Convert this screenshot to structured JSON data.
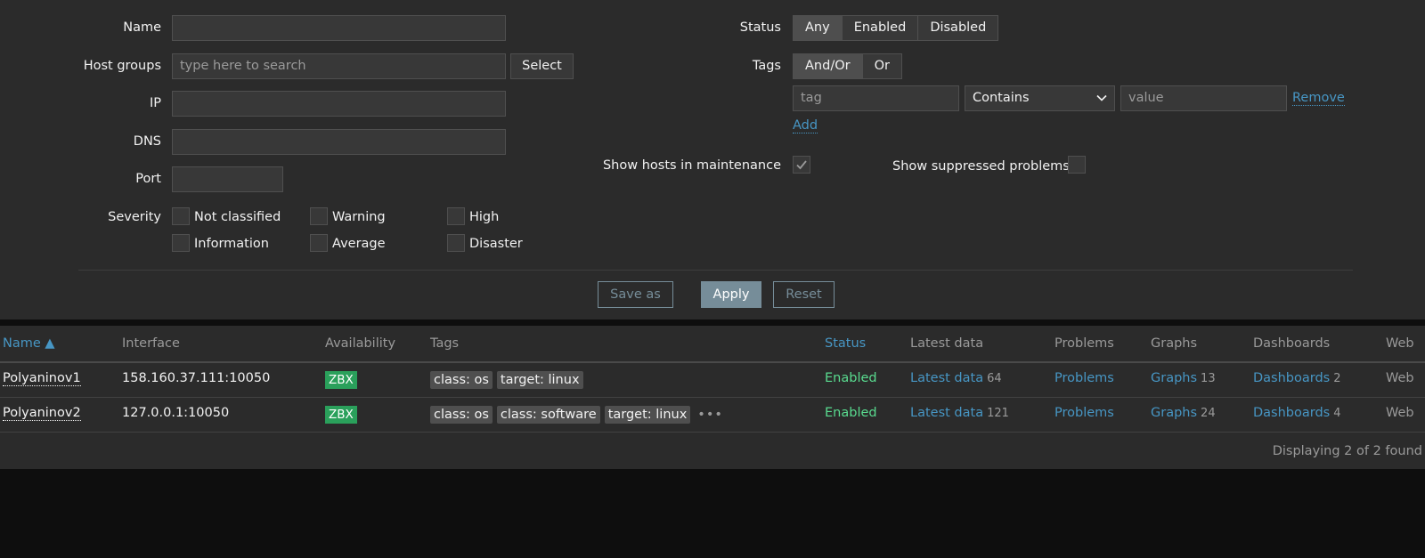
{
  "filter": {
    "name_label": "Name",
    "name_value": "",
    "hostgroups_label": "Host groups",
    "hostgroups_placeholder": "type here to search",
    "select_label": "Select",
    "ip_label": "IP",
    "ip_value": "",
    "dns_label": "DNS",
    "dns_value": "",
    "port_label": "Port",
    "port_value": "",
    "severity_label": "Severity",
    "severities": [
      "Not classified",
      "Warning",
      "High",
      "Information",
      "Average",
      "Disaster"
    ],
    "status_label": "Status",
    "status_options": [
      "Any",
      "Enabled",
      "Disabled"
    ],
    "status_selected": "Any",
    "tags_label": "Tags",
    "tags_options": [
      "And/Or",
      "Or"
    ],
    "tags_selected": "And/Or",
    "tag_placeholder": "tag",
    "tag_operator": "Contains",
    "value_placeholder": "value",
    "remove_label": "Remove",
    "add_label": "Add",
    "maintenance_label": "Show hosts in maintenance",
    "maintenance_checked": true,
    "suppressed_label": "Show suppressed problems",
    "suppressed_checked": false,
    "save_as_label": "Save as",
    "apply_label": "Apply",
    "reset_label": "Reset"
  },
  "table": {
    "columns": [
      "Name ▲",
      "Interface",
      "Availability",
      "Tags",
      "Status",
      "Latest data",
      "Problems",
      "Graphs",
      "Dashboards",
      "Web"
    ],
    "rows": [
      {
        "name": "Polyaninov1",
        "interface": "158.160.37.111:10050",
        "availability": "ZBX",
        "tags": [
          "class: os",
          "target: linux"
        ],
        "more_tags": "",
        "status": "Enabled",
        "latest_label": "Latest data",
        "latest_count": "64",
        "problems": "Problems",
        "graphs_label": "Graphs",
        "graphs_count": "13",
        "dashboards_label": "Dashboards",
        "dashboards_count": "2",
        "web": "Web"
      },
      {
        "name": "Polyaninov2",
        "interface": "127.0.0.1:10050",
        "availability": "ZBX",
        "tags": [
          "class: os",
          "class: software",
          "target: linux"
        ],
        "more_tags": "•••",
        "status": "Enabled",
        "latest_label": "Latest data",
        "latest_count": "121",
        "problems": "Problems",
        "graphs_label": "Graphs",
        "graphs_count": "24",
        "dashboards_label": "Dashboards",
        "dashboards_count": "4",
        "web": "Web"
      }
    ],
    "footer": "Displaying 2 of 2 found"
  },
  "colors": {
    "panel": "#2b2b2b",
    "background": "#0e0e0e",
    "link": "#4796c4",
    "enabled": "#59db8f",
    "zbx": "#2aa05b",
    "button": "#768d99"
  }
}
